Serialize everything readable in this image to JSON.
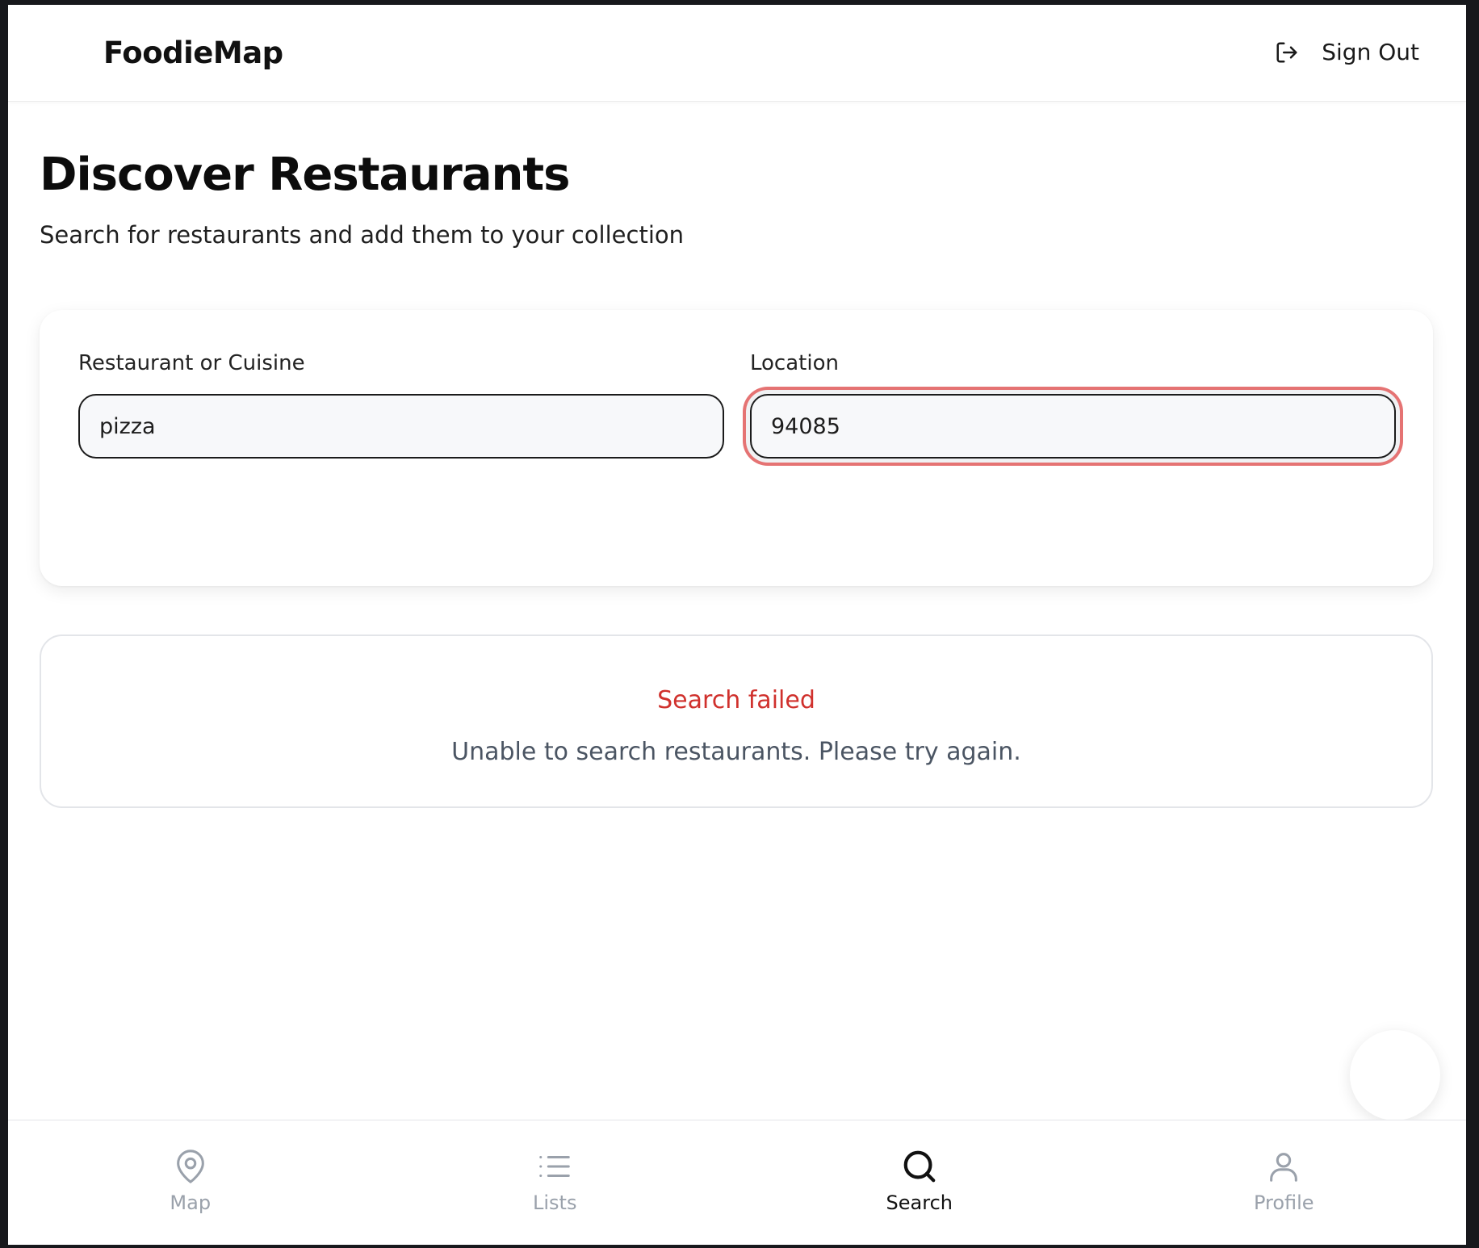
{
  "header": {
    "brand": "FoodieMap",
    "signout_label": "Sign Out"
  },
  "page": {
    "title": "Discover Restaurants",
    "subtitle": "Search for restaurants and add them to your collection"
  },
  "search": {
    "query_label": "Restaurant or Cuisine",
    "query_value": "pizza",
    "location_label": "Location",
    "location_value": "94085"
  },
  "error": {
    "title": "Search failed",
    "message": "Unable to search restaurants. Please try again."
  },
  "nav": {
    "items": [
      {
        "label": "Map",
        "icon": "map-pin-icon",
        "active": false
      },
      {
        "label": "Lists",
        "icon": "list-icon",
        "active": false
      },
      {
        "label": "Search",
        "icon": "search-icon",
        "active": true
      },
      {
        "label": "Profile",
        "icon": "user-icon",
        "active": false
      }
    ]
  },
  "colors": {
    "error_text": "#d0312d",
    "error_ring": "#e57373",
    "nav_inactive": "#9aa1ab",
    "nav_active": "#111111"
  }
}
